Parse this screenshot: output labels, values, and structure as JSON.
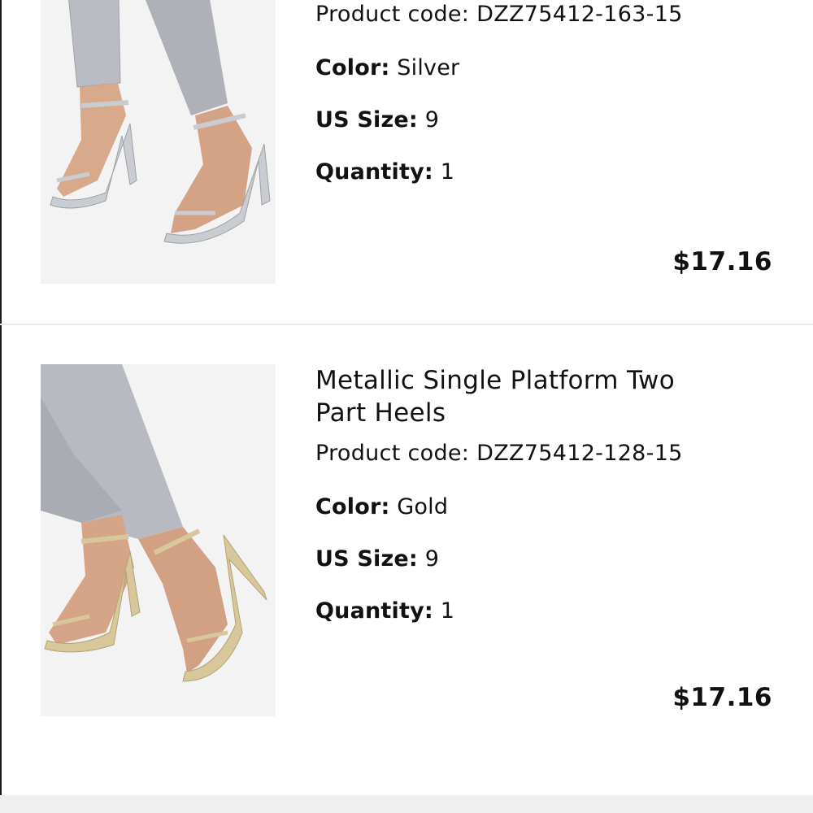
{
  "items": [
    {
      "title": "",
      "product_code_label": "Product code:",
      "product_code": "DZZ75412-163-15",
      "color_label": "Color:",
      "color_value": "Silver",
      "size_label": "US Size:",
      "size_value": "9",
      "quantity_label": "Quantity:",
      "quantity_value": "1",
      "price": "$17.16",
      "shoe_color": "#c9ccd0"
    },
    {
      "title": "Metallic Single Platform Two Part Heels",
      "product_code_label": "Product code:",
      "product_code": "DZZ75412-128-15",
      "color_label": "Color:",
      "color_value": "Gold",
      "size_label": "US Size:",
      "size_value": "9",
      "quantity_label": "Quantity:",
      "quantity_value": "1",
      "price": "$17.16",
      "shoe_color": "#d8c79a"
    }
  ]
}
